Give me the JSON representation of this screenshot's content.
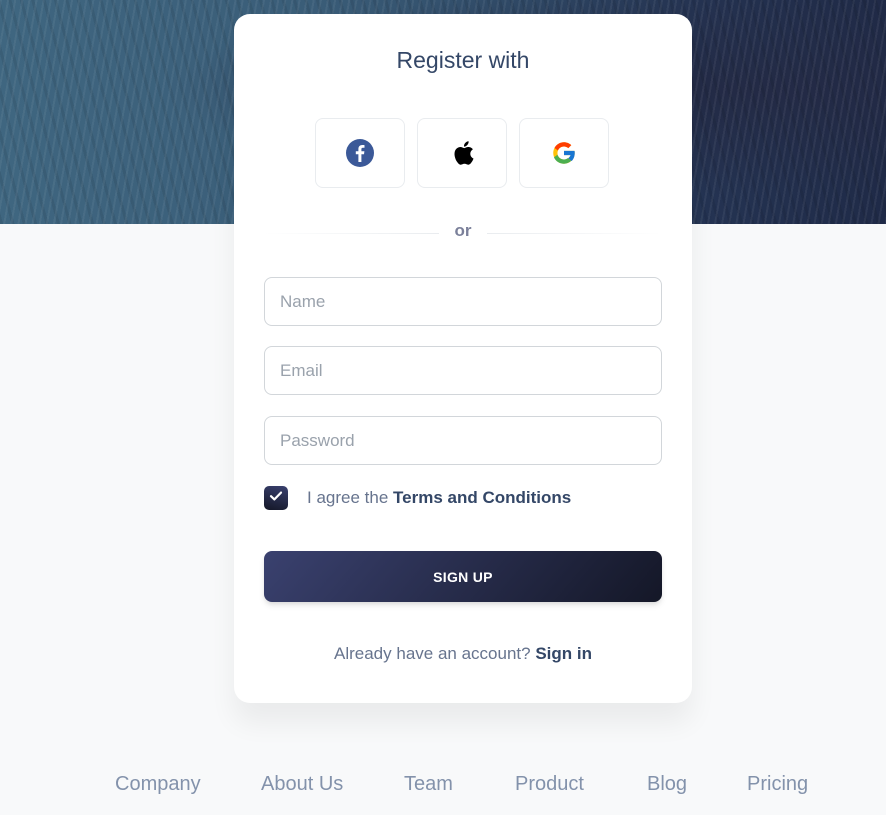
{
  "card": {
    "title": "Register with",
    "social": [
      {
        "name": "facebook-icon",
        "color": "#3b5998"
      },
      {
        "name": "apple-icon",
        "color": "#000000"
      },
      {
        "name": "google-icon",
        "color": "#4285f4"
      }
    ],
    "divider_text": "or",
    "fields": {
      "name_placeholder": "Name",
      "email_placeholder": "Email",
      "password_placeholder": "Password"
    },
    "agree": {
      "checked": true,
      "text": "I agree the ",
      "link": "Terms and Conditions"
    },
    "signup_button": "SIGN UP",
    "signin": {
      "text": "Already have an account? ",
      "link": "Sign in"
    }
  },
  "footer": {
    "links": [
      "Company",
      "About Us",
      "Team",
      "Product",
      "Blog",
      "Pricing"
    ]
  },
  "colors": {
    "accent_dark": "#141727",
    "accent_indigo": "#3a416f",
    "heading": "#344767",
    "muted": "#67748e"
  }
}
